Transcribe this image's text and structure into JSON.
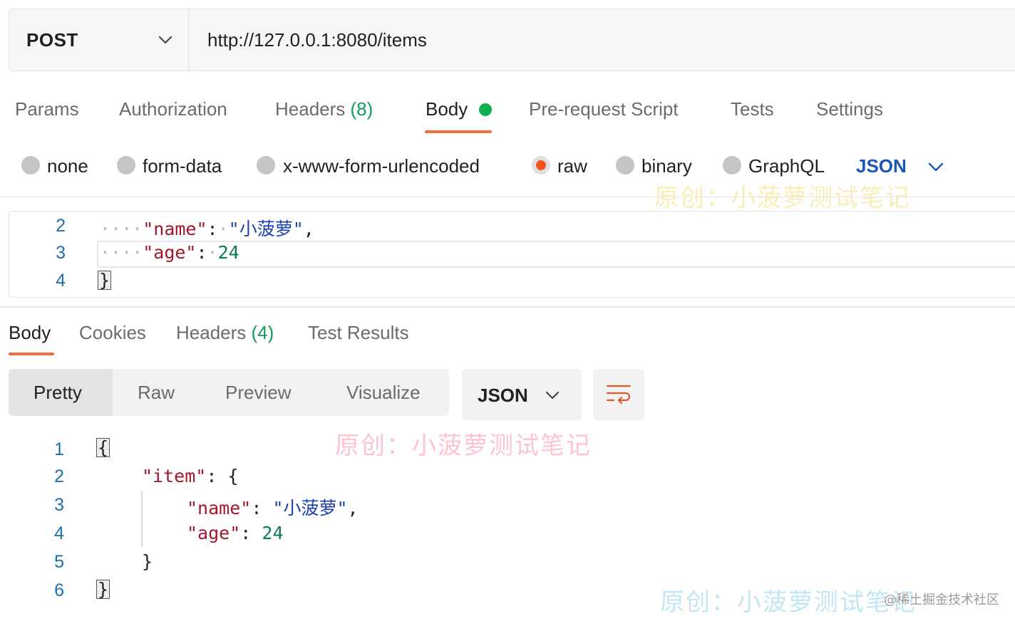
{
  "request": {
    "method": "POST",
    "url": "http://127.0.0.1:8080/items"
  },
  "request_tabs": [
    {
      "label": "Params"
    },
    {
      "label": "Authorization"
    },
    {
      "label": "Headers",
      "count": "(8)"
    },
    {
      "label": "Body",
      "active": true
    },
    {
      "label": "Pre-request Script"
    },
    {
      "label": "Tests"
    },
    {
      "label": "Settings"
    }
  ],
  "body_types": {
    "none": "none",
    "form_data": "form-data",
    "urlencoded": "x-www-form-urlencoded",
    "raw": "raw",
    "binary": "binary",
    "graphql": "GraphQL",
    "selected": "raw",
    "format": "JSON"
  },
  "request_body": {
    "line_numbers": [
      "2",
      "3",
      "4"
    ],
    "line2": {
      "indent": "····",
      "key": "\"name\"",
      "colon": ":",
      "sp": "·",
      "value": "\"小菠萝\"",
      "comma": ","
    },
    "line3": {
      "indent": "····",
      "key": "\"age\"",
      "colon": ":",
      "sp": "·",
      "value": "24"
    },
    "line4": {
      "brace": "}"
    }
  },
  "response_tabs": [
    {
      "label": "Body",
      "active": true
    },
    {
      "label": "Cookies"
    },
    {
      "label": "Headers",
      "count": "(4)"
    },
    {
      "label": "Test Results"
    }
  ],
  "view_modes": {
    "pretty": "Pretty",
    "raw": "Raw",
    "preview": "Preview",
    "visualize": "Visualize",
    "active": "Pretty"
  },
  "response_format": "JSON",
  "response_body": {
    "line_numbers": [
      "1",
      "2",
      "3",
      "4",
      "5",
      "6"
    ],
    "l1": "{",
    "l2_key": "\"item\"",
    "l2_colon": ":",
    "l2_brace": "{",
    "l3_key": "\"name\"",
    "l3_colon": ":",
    "l3_value": "\"小菠萝\"",
    "l3_comma": ",",
    "l4_key": "\"age\"",
    "l4_colon": ":",
    "l4_value": "24",
    "l5": "}",
    "l6": "}"
  },
  "watermarks": {
    "text": "原创：小菠萝测试笔记",
    "credit": "@稀土掘金技术社区"
  },
  "colors": {
    "accent": "#f26b3a",
    "body_dot": "#0fb14f",
    "json_blue": "#1b57b8",
    "raw_radio": "#f2541b"
  },
  "icons": {
    "method_dropdown": "chevron-down-icon",
    "format_dropdown": "chevron-down-icon",
    "body_format_dropdown": "chevron-down-icon",
    "wrap": "wrap-lines-icon"
  }
}
